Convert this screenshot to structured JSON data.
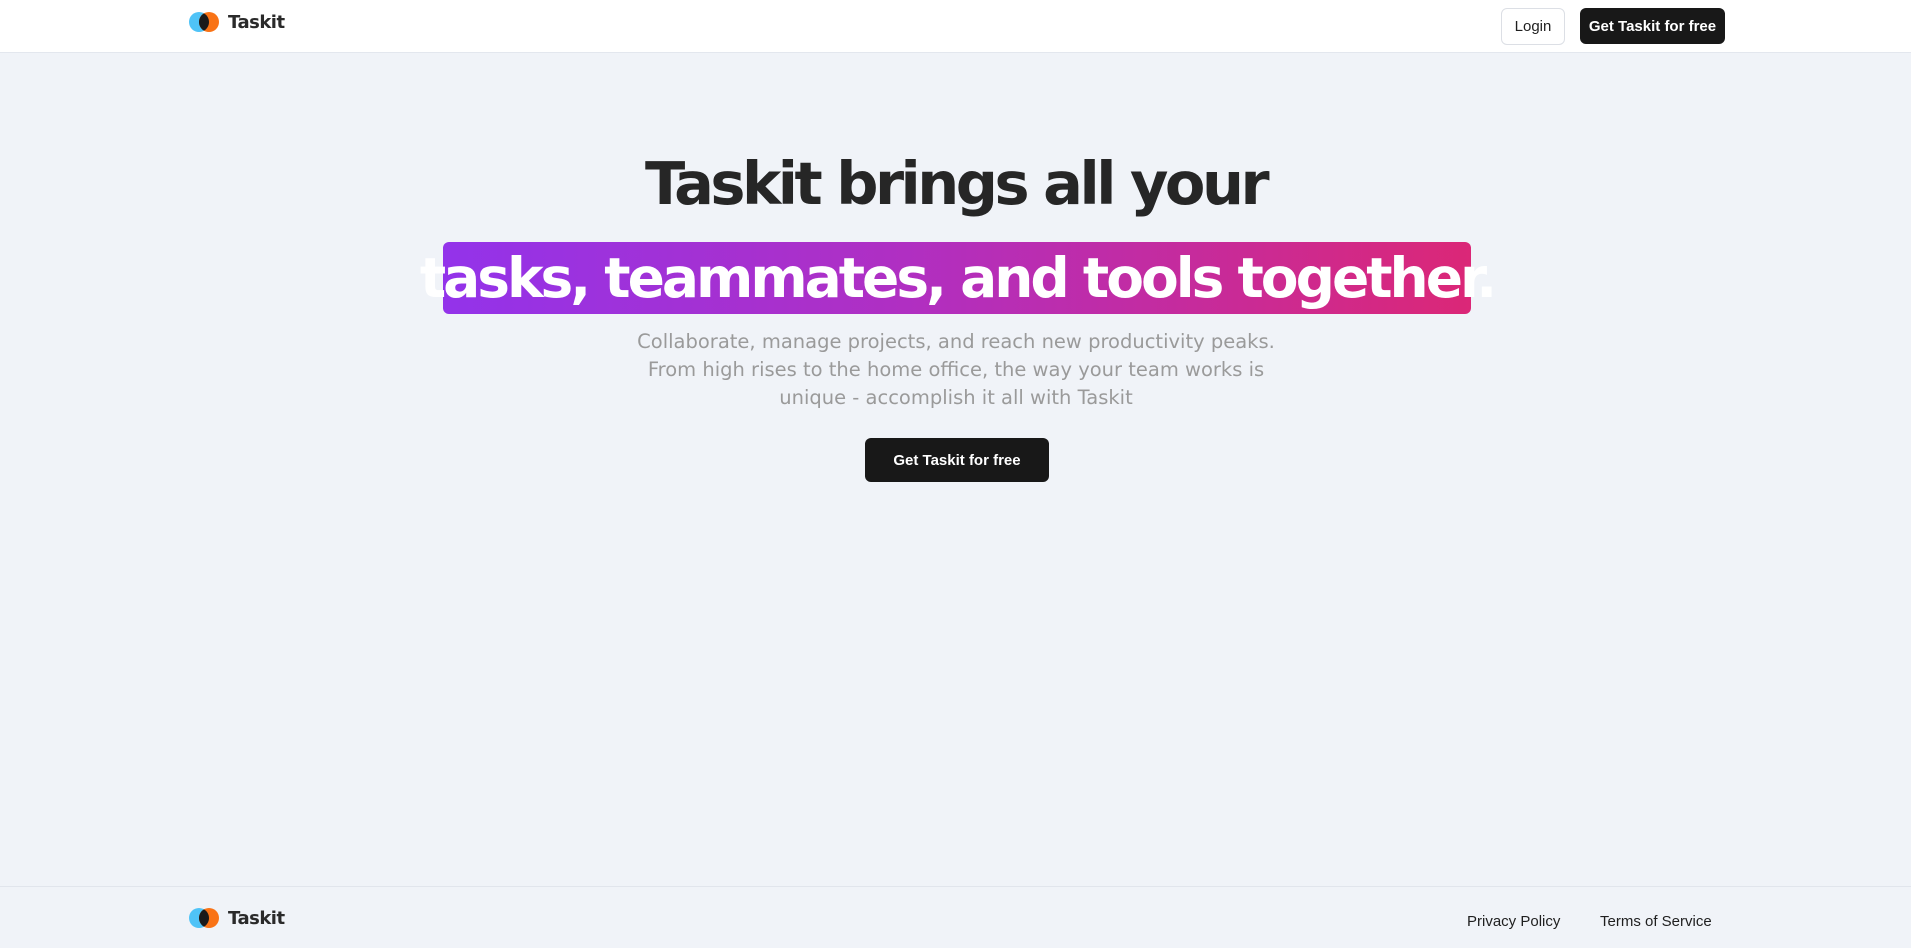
{
  "brand": {
    "name": "Taskit",
    "colors": {
      "left_circle": "#4fc3f7",
      "right_circle": "#f97316",
      "overlap": "#1a1a1a"
    }
  },
  "header": {
    "login_label": "Login",
    "cta_label": "Get Taskit for free"
  },
  "hero": {
    "title_line1": "Taskit brings all your",
    "title_line2": "tasks, teammates, and tools together.",
    "highlight_gradient": [
      "#9333ea",
      "#db2777"
    ],
    "subtitle_lines": [
      "Collaborate, manage projects, and reach new productivity peaks.",
      "From high rises to the home office, the way your team works is",
      "unique - accomplish it all with Taskit"
    ],
    "cta_label": "Get Taskit for free"
  },
  "footer": {
    "links": [
      "Privacy Policy",
      "Terms of Service"
    ]
  }
}
